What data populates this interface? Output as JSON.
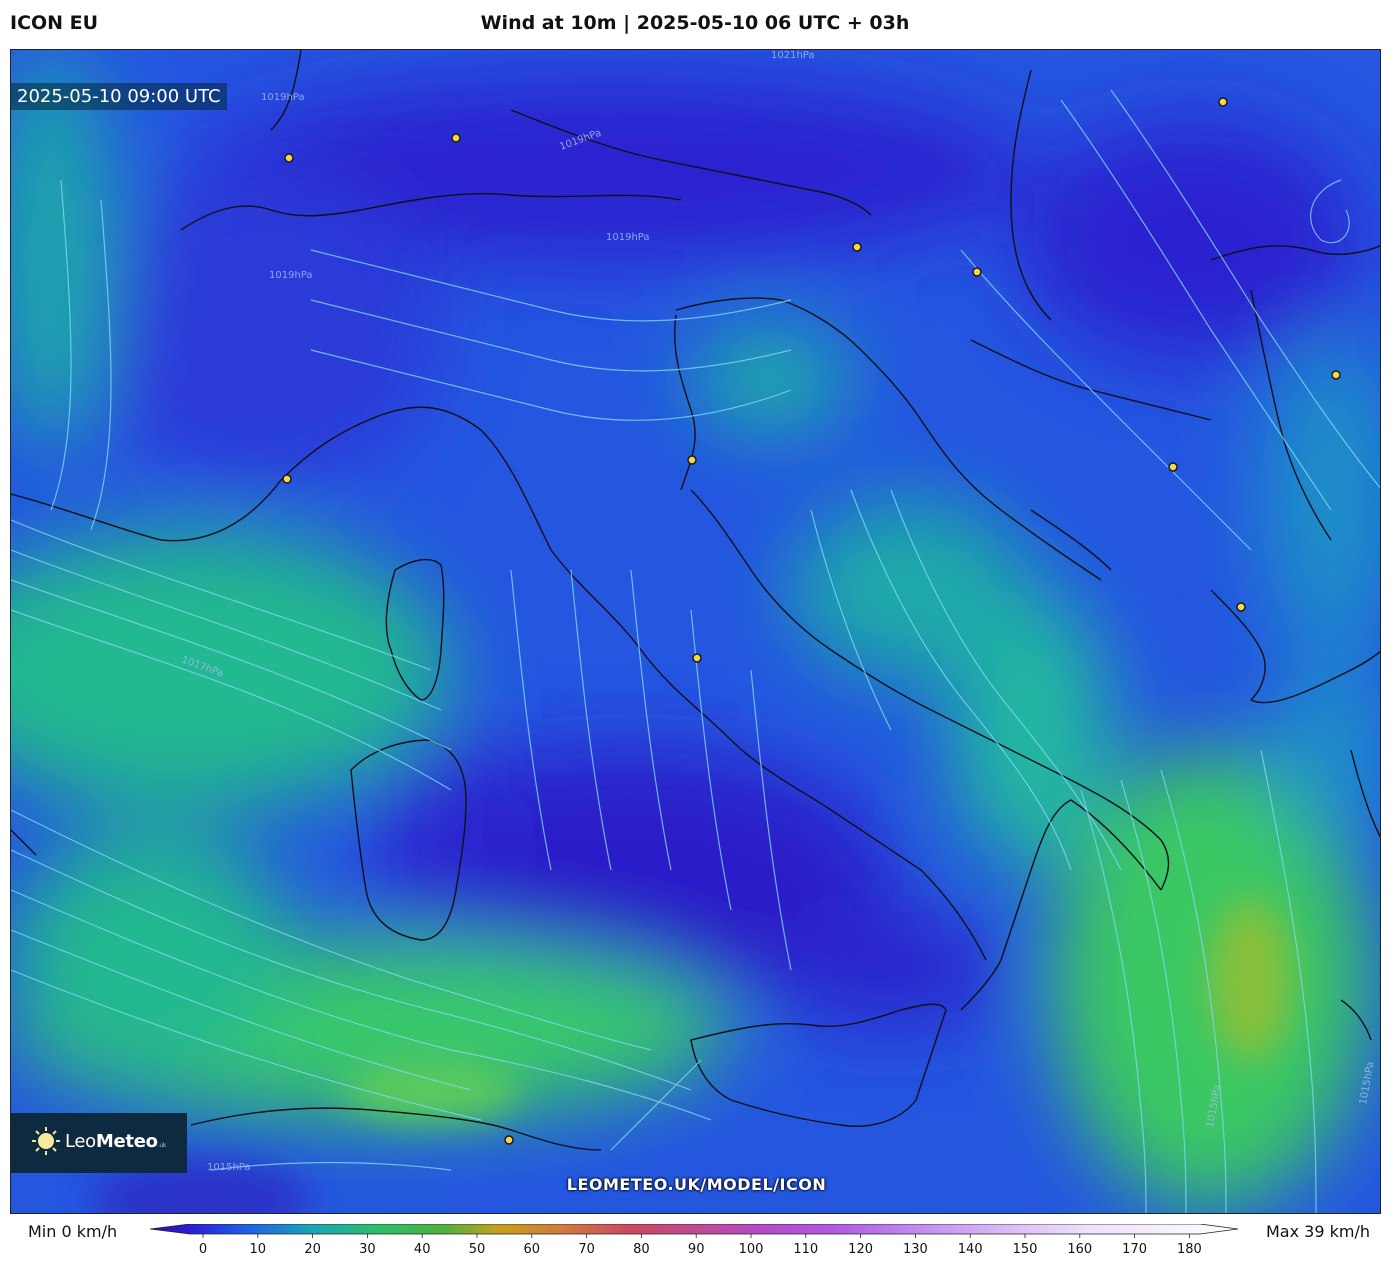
{
  "header": {
    "model": "ICON EU",
    "title": "Wind at 10m | 2025-05-10 06 UTC + 03h"
  },
  "map": {
    "valid_time": "2025-05-10 09:00 UTC",
    "isobar_labels": [
      "1021hPa",
      "1019hPa",
      "1019hPa",
      "1019hPa",
      "1019hPa",
      "1017hPa",
      "1015hPa",
      "1015hPa",
      "1015hPa"
    ],
    "watermark": "LEOMETEO.UK/MODEL/ICON",
    "brand": {
      "name_light": "Leo",
      "name_bold": "Meteo",
      "suffix": ".uk"
    },
    "colors": {
      "calm": "#2a1fd0",
      "light": "#1f6ae8",
      "moderate": "#19b8a0",
      "fresh": "#2fcf6a",
      "strong": "#8fcf30"
    }
  },
  "legend": {
    "min_label": "Min 0 km/h",
    "max_label": "Max 39 km/h",
    "ticks": [
      "0",
      "10",
      "20",
      "30",
      "40",
      "50",
      "60",
      "70",
      "80",
      "90",
      "100",
      "110",
      "120",
      "130",
      "140",
      "150",
      "160",
      "170",
      "180"
    ],
    "unit": "km/h"
  }
}
